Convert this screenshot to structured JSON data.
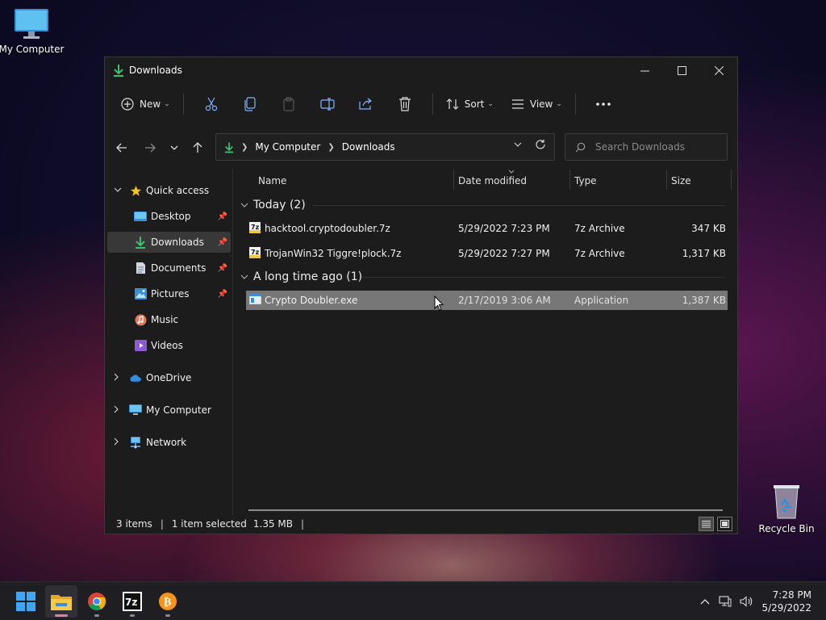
{
  "desktop": {
    "my_computer_label": "My Computer",
    "recycle_bin_label": "Recycle Bin"
  },
  "window": {
    "title": "Downloads",
    "controls": {
      "minimize": "minimize",
      "maximize": "maximize",
      "close": "close"
    }
  },
  "toolbar": {
    "new_label": "New",
    "sort_label": "Sort",
    "view_label": "View",
    "icons": [
      "cut-icon",
      "copy-icon",
      "paste-icon",
      "rename-icon",
      "share-icon",
      "delete-icon",
      "more-icon"
    ]
  },
  "address": {
    "crumbs": [
      "My Computer",
      "Downloads"
    ],
    "search_placeholder": "Search Downloads"
  },
  "sidebar": {
    "quick_access": "Quick access",
    "items": [
      {
        "label": "Desktop",
        "icon": "desktop-folder-icon",
        "pinned": true
      },
      {
        "label": "Downloads",
        "icon": "downloads-folder-icon",
        "pinned": true,
        "selected": true
      },
      {
        "label": "Documents",
        "icon": "documents-folder-icon",
        "pinned": true
      },
      {
        "label": "Pictures",
        "icon": "pictures-folder-icon",
        "pinned": true
      },
      {
        "label": "Music",
        "icon": "music-folder-icon",
        "pinned": false
      },
      {
        "label": "Videos",
        "icon": "videos-folder-icon",
        "pinned": false
      }
    ],
    "roots": [
      {
        "label": "OneDrive",
        "icon": "onedrive-icon"
      },
      {
        "label": "My Computer",
        "icon": "computer-icon"
      },
      {
        "label": "Network",
        "icon": "network-icon"
      }
    ]
  },
  "columns": {
    "name": "Name",
    "date": "Date modified",
    "type": "Type",
    "size": "Size"
  },
  "groups": [
    {
      "label": "Today (2)",
      "files": [
        {
          "name": "hacktool.cryptodoubler.7z",
          "date": "5/29/2022 7:23 PM",
          "type": "7z Archive",
          "size": "347 KB",
          "icon": "7z-archive-icon"
        },
        {
          "name": "TrojanWin32 Tiggre!plock.7z",
          "date": "5/29/2022 7:27 PM",
          "type": "7z Archive",
          "size": "1,317 KB",
          "icon": "7z-archive-icon"
        }
      ]
    },
    {
      "label": "A long time ago (1)",
      "files": [
        {
          "name": "Crypto Doubler.exe",
          "date": "2/17/2019 3:06 AM",
          "type": "Application",
          "size": "1,387 KB",
          "icon": "application-icon",
          "selected": true
        }
      ]
    }
  ],
  "status": {
    "items": "3 items",
    "selected": "1 item selected",
    "size": "1.35 MB"
  },
  "taskbar": {
    "apps": [
      "start-icon",
      "file-explorer-icon",
      "chrome-icon",
      "7zip-icon",
      "bitcoin-icon"
    ],
    "clock_time": "7:28 PM",
    "clock_date": "5/29/2022"
  },
  "colors": {
    "accent_green": "#3fbf6f",
    "folder_yellow": "#f2c744",
    "selection_gray": "#777777",
    "window_bg": "#1c1c1c"
  }
}
